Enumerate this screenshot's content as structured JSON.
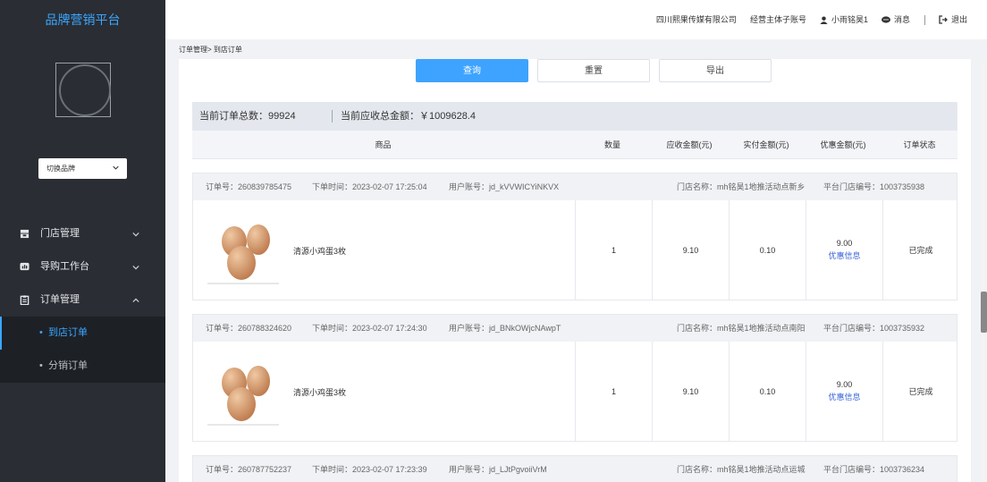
{
  "sidebar": {
    "title": "品牌营销平台",
    "brand_select": "切换品牌",
    "menu": [
      {
        "label": "门店管理",
        "icon": "store-icon"
      },
      {
        "label": "导购工作台",
        "icon": "workbench-icon"
      },
      {
        "label": "订单管理",
        "icon": "clipboard-icon"
      }
    ],
    "submenu": [
      {
        "label": "到店订单",
        "active": true
      },
      {
        "label": "分销订单",
        "active": false
      }
    ]
  },
  "topbar": {
    "company": "四川熙果传媒有限公司",
    "account_type": "经营主体子账号",
    "user": "小雨铭昊1",
    "messages": "消息",
    "logout": "退出"
  },
  "breadcrumb": "订单管理> 到店订单",
  "buttons": {
    "search": "查询",
    "reset": "重置",
    "export": "导出"
  },
  "summary": {
    "total_orders": "当前订单总数：99924",
    "total_amount": "当前应收总金额：￥1009628.4"
  },
  "columns": [
    "商品",
    "数量",
    "应收金额(元)",
    "实付金额(元)",
    "优惠金额(元)",
    "订单状态"
  ],
  "orders": [
    {
      "order_no": "订单号：260839785475",
      "order_time": "下单时间：2023-02-07 17:25:04",
      "user_account": "用户账号：jd_kVVWICYiNKVX",
      "store_name": "门店名称：mh铭昊1地推活动点新乡",
      "store_code": "平台门店编号：1003735938",
      "product": "清源小鸡蛋3枚",
      "qty": "1",
      "receivable": "9.10",
      "paid": "0.10",
      "discount": "9.00",
      "discount_link": "优惠信息",
      "status": "已完成"
    },
    {
      "order_no": "订单号：260788324620",
      "order_time": "下单时间：2023-02-07 17:24:30",
      "user_account": "用户账号：jd_BNkOWjcNAwpT",
      "store_name": "门店名称：mh铭昊1地推活动点南阳",
      "store_code": "平台门店编号：1003735932",
      "product": "清源小鸡蛋3枚",
      "qty": "1",
      "receivable": "9.10",
      "paid": "0.10",
      "discount": "9.00",
      "discount_link": "优惠信息",
      "status": "已完成"
    },
    {
      "order_no": "订单号：260787752237",
      "order_time": "下单时间：2023-02-07 17:23:39",
      "user_account": "用户账号：jd_LJtPgvoiiVrM",
      "store_name": "门店名称：mh铭昊1地推活动点运城",
      "store_code": "平台门店编号：1003736234"
    }
  ],
  "colors": {
    "accent": "#3ea3ff",
    "sidebar": "#2a2d33",
    "link": "#3b64d8"
  }
}
